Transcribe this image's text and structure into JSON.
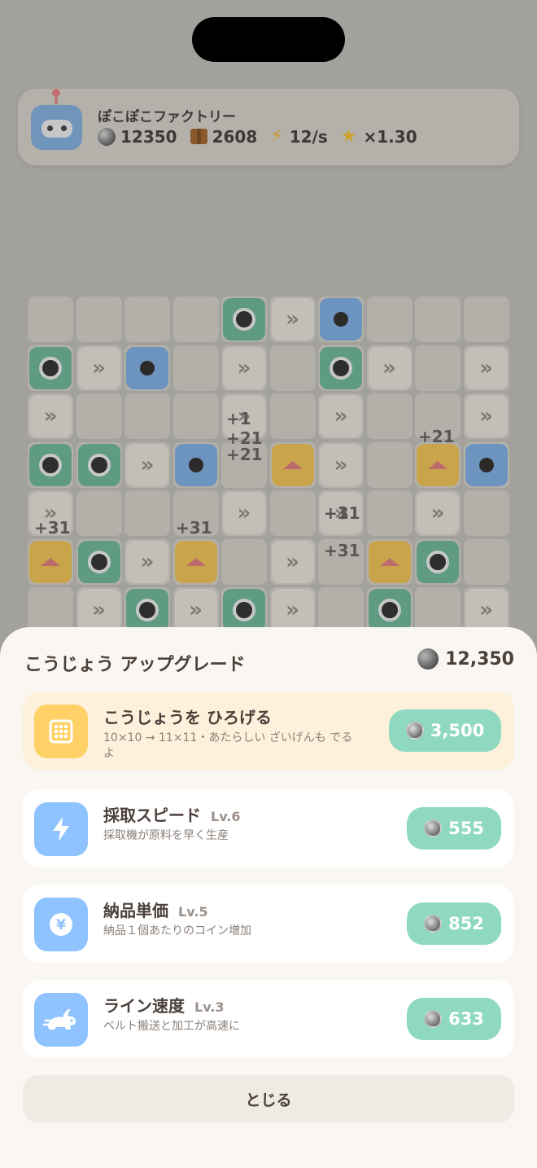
{
  "header": {
    "title": "ぽこぽこファクトリー",
    "coins": "12350",
    "boxes": "2608",
    "rate": "12/s",
    "multiplier": "×1.30"
  },
  "board": {
    "popups": [
      "+52",
      "+21",
      "+21",
      "+31",
      "+31",
      "+31",
      "+31",
      "+1",
      "+1"
    ]
  },
  "sheet": {
    "title": "こうじょう アップグレード",
    "coins": "12,350",
    "close_label": "とじる",
    "upgrades": [
      {
        "icon": "grid-icon",
        "title": "こうじょうを ひろげる",
        "level": "",
        "desc": "10×10 → 11×11・あたらしい ざいげんも でるよ",
        "price": "3,500",
        "highlight": true,
        "color": "#ffd166"
      },
      {
        "icon": "lightning-icon",
        "title": "採取スピード",
        "level": "Lv.6",
        "desc": "採取機が原料を早く生産",
        "price": "555",
        "highlight": false,
        "color": "#8ec3ff"
      },
      {
        "icon": "yen-icon",
        "title": "納品単価",
        "level": "Lv.5",
        "desc": "納品１個あたりのコイン増加",
        "price": "852",
        "highlight": false,
        "color": "#8ec3ff"
      },
      {
        "icon": "rabbit-icon",
        "title": "ライン速度",
        "level": "Lv.3",
        "desc": "ベルト搬送と加工が高速に",
        "price": "633",
        "highlight": false,
        "color": "#8ec3ff"
      }
    ]
  }
}
